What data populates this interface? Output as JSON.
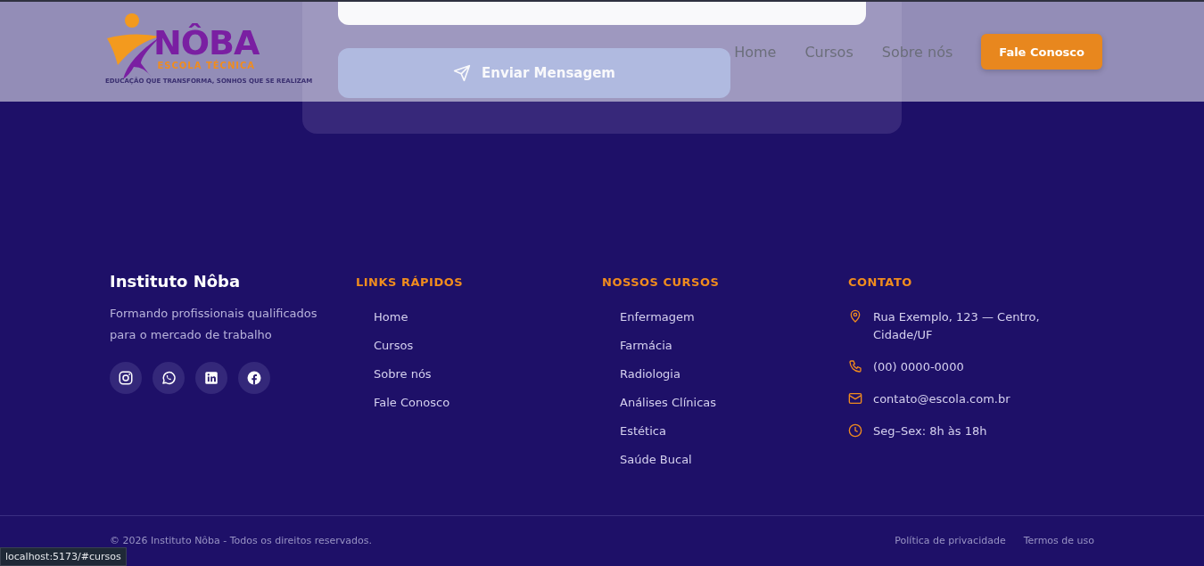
{
  "form_card": {
    "submit_button": "Enviar Mensagem"
  },
  "header": {
    "logo": {
      "name": "NÔBA",
      "subtitle": "ESCOLA TÉCNICA",
      "tagline": "EDUCAÇÃO QUE TRANSFORMA, SONHOS QUE SE REALIZAM"
    },
    "nav": [
      {
        "label": "Home"
      },
      {
        "label": "Cursos"
      },
      {
        "label": "Sobre nós"
      }
    ],
    "cta_button": "Fale Conosco"
  },
  "footer": {
    "brand": {
      "title": "Instituto Nôba",
      "description": "Formando profissionais qualificados para o mercado de trabalho",
      "social": [
        {
          "kind": "instagram"
        },
        {
          "kind": "whatsapp"
        },
        {
          "kind": "linkedin"
        },
        {
          "kind": "facebook"
        }
      ]
    },
    "columns": [
      {
        "title": "LINKS RÁPIDOS",
        "items": [
          "Home",
          "Cursos",
          "Sobre nós",
          "Fale Conosco"
        ]
      },
      {
        "title": "NOSSOS CURSOS",
        "items": [
          "Enfermagem",
          "Farmácia",
          "Radiologia",
          "Análises Clínicas",
          "Estética",
          "Saúde Bucal"
        ]
      }
    ],
    "contact": {
      "title": "CONTATO",
      "items": [
        {
          "kind": "address",
          "text": "Rua Exemplo, 123 — Centro, Cidade/UF"
        },
        {
          "kind": "phone",
          "text": "(00) 0000-0000"
        },
        {
          "kind": "email",
          "text": "contato@escola.com.br"
        },
        {
          "kind": "hours",
          "text": "Seg–Sex: 8h às 18h"
        }
      ]
    },
    "copyright": "© 2026 Instituto Nôba - Todos os direitos reservados.",
    "legal_links": [
      "Política de privacidade",
      "Termos de uso"
    ]
  },
  "status_bar": {
    "url": "localhost:5173/#cursos"
  }
}
